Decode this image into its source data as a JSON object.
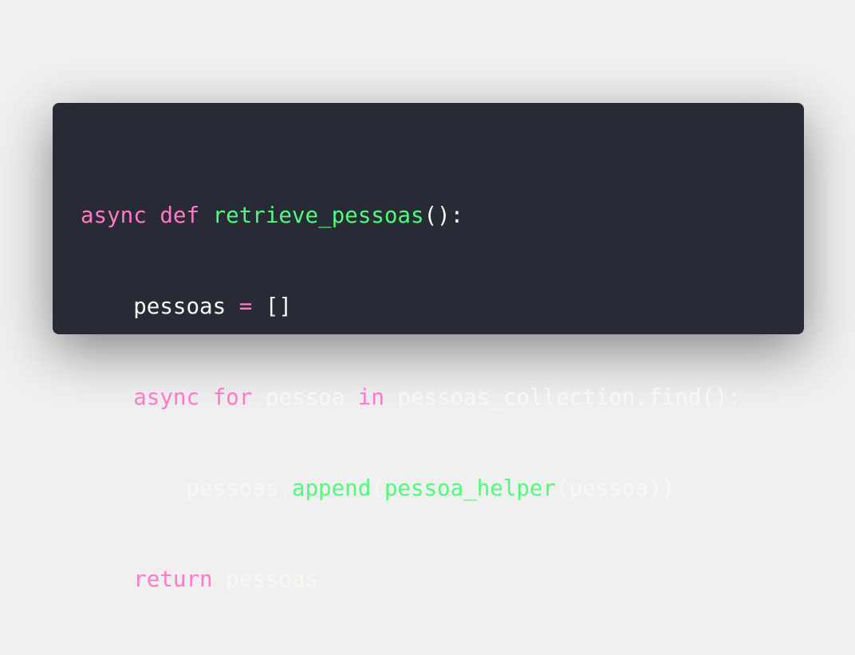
{
  "colors": {
    "background": "#f0f0f0",
    "editor_background": "#282a36",
    "keyword": "#ff79c6",
    "function": "#50fa7b",
    "text": "#f8f8f2"
  },
  "code": {
    "line1": {
      "kw_async": "async",
      "sp1": " ",
      "kw_def": "def",
      "sp2": " ",
      "fn_name": "retrieve_pessoas",
      "rest": "():"
    },
    "line2": {
      "indent": "    ",
      "var": "pessoas ",
      "op": "=",
      "rest": " []"
    },
    "line3": {
      "indent": "    ",
      "kw_async": "async",
      "sp1": " ",
      "kw_for": "for",
      "mid": " pessoa ",
      "kw_in": "in",
      "rest": " pessoas_collection.find():"
    },
    "line4": {
      "indent": "        ",
      "obj": "pessoas.",
      "fn_append": "append",
      "paren1": "(",
      "fn_helper": "pessoa_helper",
      "rest": "(pessoa))"
    },
    "line5": {
      "indent": "    ",
      "kw_return": "return",
      "rest": " pessoas"
    }
  }
}
